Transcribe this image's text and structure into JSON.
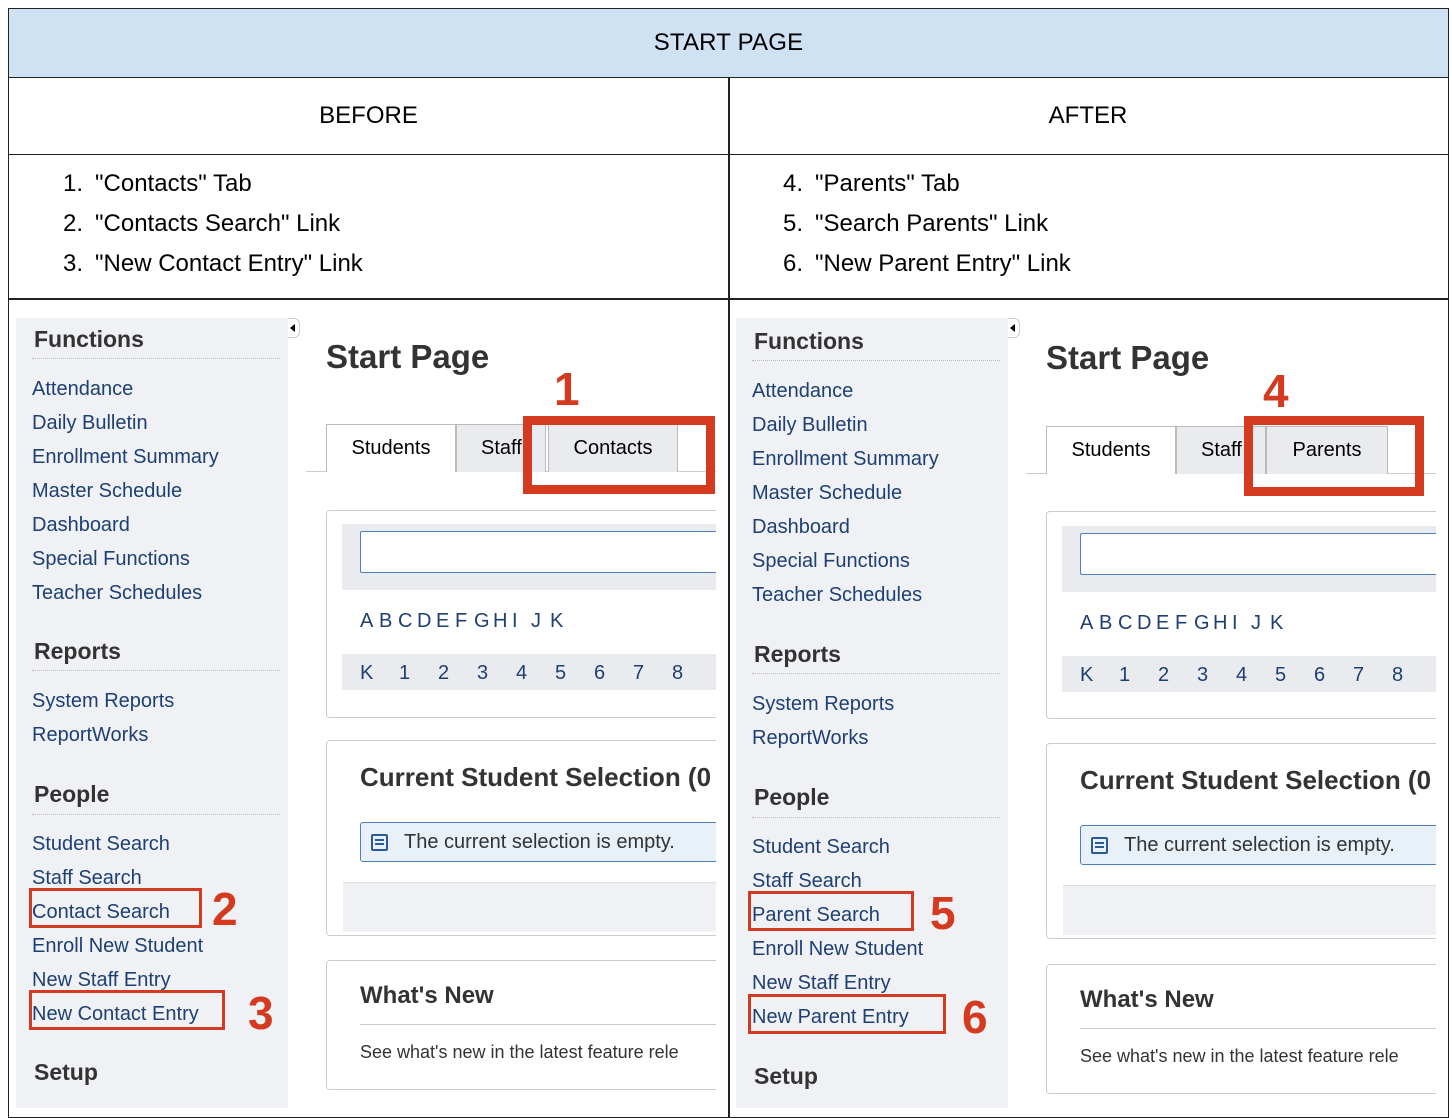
{
  "header": {
    "title": "START PAGE",
    "before": "BEFORE",
    "after": "AFTER"
  },
  "before_steps": [
    {
      "num": "1.",
      "text": "\"Contacts\" Tab"
    },
    {
      "num": "2.",
      "text": "\"Contacts Search\" Link"
    },
    {
      "num": "3.",
      "text": "\"New Contact Entry\" Link"
    }
  ],
  "after_steps": [
    {
      "num": "4.",
      "text": "\"Parents\" Tab"
    },
    {
      "num": "5.",
      "text": "\"Search Parents\" Link"
    },
    {
      "num": "6.",
      "text": "\"New Parent Entry\" Link"
    }
  ],
  "sidebar": {
    "functions": "Functions",
    "function_links": [
      "Attendance",
      "Daily Bulletin",
      "Enrollment Summary",
      "Master Schedule",
      "Dashboard",
      "Special Functions",
      "Teacher Schedules"
    ],
    "reports": "Reports",
    "report_links": [
      "System Reports",
      "ReportWorks"
    ],
    "people": "People",
    "setup": "Setup"
  },
  "before_people": [
    "Student Search",
    "Staff Search",
    "Contact Search",
    "Enroll New Student",
    "New Staff Entry",
    "New Contact Entry"
  ],
  "after_people": [
    "Student Search",
    "Staff Search",
    "Parent Search",
    "Enroll New Student",
    "New Staff Entry",
    "New Parent Entry"
  ],
  "main": {
    "title": "Start Page",
    "tab_students": "Students",
    "tab_staff": "Staff",
    "tab_contacts": "Contacts",
    "tab_parents": "Parents",
    "letters": [
      "A",
      "B",
      "C",
      "D",
      "E",
      "F",
      "G",
      "H",
      "I",
      "J",
      "K"
    ],
    "grades": [
      "K",
      "1",
      "2",
      "3",
      "4",
      "5",
      "6",
      "7",
      "8"
    ],
    "selection_title_left": "Current Student Selection (0",
    "selection_title_right": "Current Student Selection (0",
    "selection_empty": "The current selection is empty.",
    "whats_new": "What's New",
    "whats_new_text_left": "See what's new in the latest feature rele",
    "whats_new_text_right": "See what's new in the latest feature rele"
  },
  "callouts": {
    "n1": "1",
    "n2": "2",
    "n3": "3",
    "n4": "4",
    "n5": "5",
    "n6": "6"
  },
  "colors": {
    "highlight": "#d33a1f",
    "title_bg": "#cfe2f3",
    "link": "#1d3f74"
  }
}
